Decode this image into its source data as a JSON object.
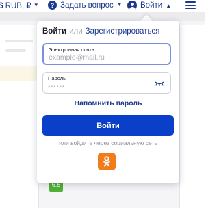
{
  "header": {
    "currency_label": "RUB, ₽",
    "ask_label": "Задать вопрос",
    "login_label": "Войти",
    "currency_icon": "currency-icon",
    "question_icon": "question-circle-icon",
    "user_icon": "user-icon",
    "menu_icon": "hamburger-menu-icon"
  },
  "background": {
    "badge_value": "6.5",
    "badge_color": "#4fb135"
  },
  "login_popup": {
    "tab_login": "Войти",
    "tab_separator": "или",
    "tab_register": "Зарегистрироваться",
    "email_label": "Электронная почта",
    "email_placeholder": "example@mail.ru",
    "email_value": "",
    "password_label": "Пароль",
    "password_placeholder": "••••••",
    "password_value": "",
    "remind_link": "Напомнить пароль",
    "submit_label": "Войти",
    "social_text": "или войдите через социальную сеть",
    "social_icon": "odnoklassniki-icon",
    "colors": {
      "primary": "#0a3fc9",
      "link": "#1b3a8f",
      "ok_brand": "#f07c1a",
      "focus_border": "#7d8fe0"
    }
  }
}
